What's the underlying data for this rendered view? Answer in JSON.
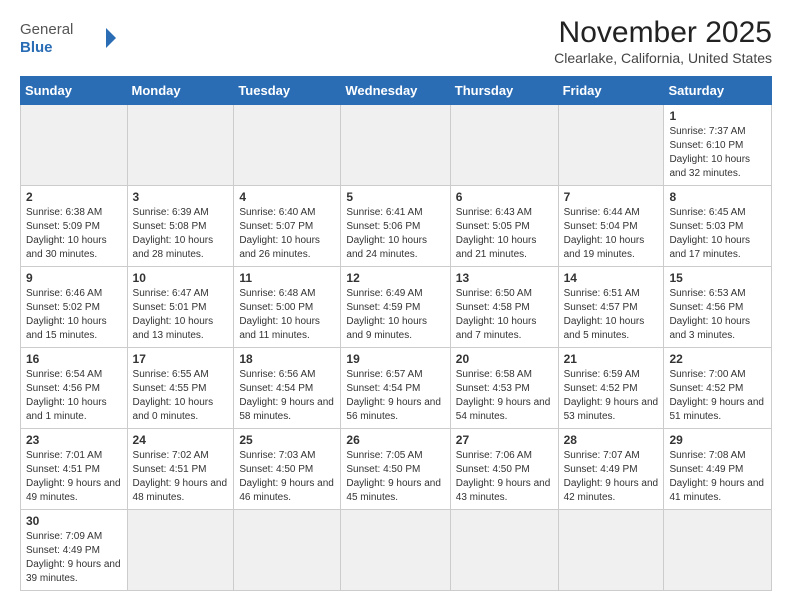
{
  "header": {
    "logo_text_general": "General",
    "logo_text_blue": "Blue",
    "month_title": "November 2025",
    "location": "Clearlake, California, United States"
  },
  "days_of_week": [
    "Sunday",
    "Monday",
    "Tuesday",
    "Wednesday",
    "Thursday",
    "Friday",
    "Saturday"
  ],
  "weeks": [
    [
      {
        "day": "",
        "info": "",
        "empty": true
      },
      {
        "day": "",
        "info": "",
        "empty": true
      },
      {
        "day": "",
        "info": "",
        "empty": true
      },
      {
        "day": "",
        "info": "",
        "empty": true
      },
      {
        "day": "",
        "info": "",
        "empty": true
      },
      {
        "day": "",
        "info": "",
        "empty": true
      },
      {
        "day": "1",
        "info": "Sunrise: 7:37 AM\nSunset: 6:10 PM\nDaylight: 10 hours and 32 minutes.",
        "empty": false
      }
    ],
    [
      {
        "day": "2",
        "info": "Sunrise: 6:38 AM\nSunset: 5:09 PM\nDaylight: 10 hours and 30 minutes.",
        "empty": false
      },
      {
        "day": "3",
        "info": "Sunrise: 6:39 AM\nSunset: 5:08 PM\nDaylight: 10 hours and 28 minutes.",
        "empty": false
      },
      {
        "day": "4",
        "info": "Sunrise: 6:40 AM\nSunset: 5:07 PM\nDaylight: 10 hours and 26 minutes.",
        "empty": false
      },
      {
        "day": "5",
        "info": "Sunrise: 6:41 AM\nSunset: 5:06 PM\nDaylight: 10 hours and 24 minutes.",
        "empty": false
      },
      {
        "day": "6",
        "info": "Sunrise: 6:43 AM\nSunset: 5:05 PM\nDaylight: 10 hours and 21 minutes.",
        "empty": false
      },
      {
        "day": "7",
        "info": "Sunrise: 6:44 AM\nSunset: 5:04 PM\nDaylight: 10 hours and 19 minutes.",
        "empty": false
      },
      {
        "day": "8",
        "info": "Sunrise: 6:45 AM\nSunset: 5:03 PM\nDaylight: 10 hours and 17 minutes.",
        "empty": false
      }
    ],
    [
      {
        "day": "9",
        "info": "Sunrise: 6:46 AM\nSunset: 5:02 PM\nDaylight: 10 hours and 15 minutes.",
        "empty": false
      },
      {
        "day": "10",
        "info": "Sunrise: 6:47 AM\nSunset: 5:01 PM\nDaylight: 10 hours and 13 minutes.",
        "empty": false
      },
      {
        "day": "11",
        "info": "Sunrise: 6:48 AM\nSunset: 5:00 PM\nDaylight: 10 hours and 11 minutes.",
        "empty": false
      },
      {
        "day": "12",
        "info": "Sunrise: 6:49 AM\nSunset: 4:59 PM\nDaylight: 10 hours and 9 minutes.",
        "empty": false
      },
      {
        "day": "13",
        "info": "Sunrise: 6:50 AM\nSunset: 4:58 PM\nDaylight: 10 hours and 7 minutes.",
        "empty": false
      },
      {
        "day": "14",
        "info": "Sunrise: 6:51 AM\nSunset: 4:57 PM\nDaylight: 10 hours and 5 minutes.",
        "empty": false
      },
      {
        "day": "15",
        "info": "Sunrise: 6:53 AM\nSunset: 4:56 PM\nDaylight: 10 hours and 3 minutes.",
        "empty": false
      }
    ],
    [
      {
        "day": "16",
        "info": "Sunrise: 6:54 AM\nSunset: 4:56 PM\nDaylight: 10 hours and 1 minute.",
        "empty": false
      },
      {
        "day": "17",
        "info": "Sunrise: 6:55 AM\nSunset: 4:55 PM\nDaylight: 10 hours and 0 minutes.",
        "empty": false
      },
      {
        "day": "18",
        "info": "Sunrise: 6:56 AM\nSunset: 4:54 PM\nDaylight: 9 hours and 58 minutes.",
        "empty": false
      },
      {
        "day": "19",
        "info": "Sunrise: 6:57 AM\nSunset: 4:54 PM\nDaylight: 9 hours and 56 minutes.",
        "empty": false
      },
      {
        "day": "20",
        "info": "Sunrise: 6:58 AM\nSunset: 4:53 PM\nDaylight: 9 hours and 54 minutes.",
        "empty": false
      },
      {
        "day": "21",
        "info": "Sunrise: 6:59 AM\nSunset: 4:52 PM\nDaylight: 9 hours and 53 minutes.",
        "empty": false
      },
      {
        "day": "22",
        "info": "Sunrise: 7:00 AM\nSunset: 4:52 PM\nDaylight: 9 hours and 51 minutes.",
        "empty": false
      }
    ],
    [
      {
        "day": "23",
        "info": "Sunrise: 7:01 AM\nSunset: 4:51 PM\nDaylight: 9 hours and 49 minutes.",
        "empty": false
      },
      {
        "day": "24",
        "info": "Sunrise: 7:02 AM\nSunset: 4:51 PM\nDaylight: 9 hours and 48 minutes.",
        "empty": false
      },
      {
        "day": "25",
        "info": "Sunrise: 7:03 AM\nSunset: 4:50 PM\nDaylight: 9 hours and 46 minutes.",
        "empty": false
      },
      {
        "day": "26",
        "info": "Sunrise: 7:05 AM\nSunset: 4:50 PM\nDaylight: 9 hours and 45 minutes.",
        "empty": false
      },
      {
        "day": "27",
        "info": "Sunrise: 7:06 AM\nSunset: 4:50 PM\nDaylight: 9 hours and 43 minutes.",
        "empty": false
      },
      {
        "day": "28",
        "info": "Sunrise: 7:07 AM\nSunset: 4:49 PM\nDaylight: 9 hours and 42 minutes.",
        "empty": false
      },
      {
        "day": "29",
        "info": "Sunrise: 7:08 AM\nSunset: 4:49 PM\nDaylight: 9 hours and 41 minutes.",
        "empty": false
      }
    ],
    [
      {
        "day": "30",
        "info": "Sunrise: 7:09 AM\nSunset: 4:49 PM\nDaylight: 9 hours and 39 minutes.",
        "empty": false
      },
      {
        "day": "",
        "info": "",
        "empty": true
      },
      {
        "day": "",
        "info": "",
        "empty": true
      },
      {
        "day": "",
        "info": "",
        "empty": true
      },
      {
        "day": "",
        "info": "",
        "empty": true
      },
      {
        "day": "",
        "info": "",
        "empty": true
      },
      {
        "day": "",
        "info": "",
        "empty": true
      }
    ]
  ]
}
